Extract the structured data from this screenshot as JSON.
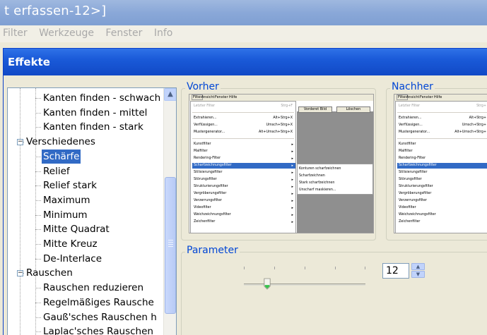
{
  "app": {
    "title": "t erfassen-12>]",
    "menu": [
      "Filter",
      "Werkzeuge",
      "Fenster",
      "Info"
    ]
  },
  "dialog": {
    "title": "Effekte"
  },
  "tree": {
    "items": [
      {
        "label": "Kanten finden - schwach",
        "level": 2
      },
      {
        "label": "Kanten finden - mittel",
        "level": 2
      },
      {
        "label": "Kanten finden - stark",
        "level": 2
      },
      {
        "label": "Verschiedenes",
        "level": 1,
        "expanded": true
      },
      {
        "label": "Schärfe",
        "level": 2,
        "selected": true
      },
      {
        "label": "Relief",
        "level": 2
      },
      {
        "label": "Relief stark",
        "level": 2
      },
      {
        "label": "Maximum",
        "level": 2
      },
      {
        "label": "Minimum",
        "level": 2
      },
      {
        "label": "Mitte Quadrat",
        "level": 2
      },
      {
        "label": "Mitte Kreuz",
        "level": 2
      },
      {
        "label": "De-Interlace",
        "level": 2
      },
      {
        "label": "Rauschen",
        "level": 1,
        "expanded": true
      },
      {
        "label": "Rauschen reduzieren",
        "level": 2
      },
      {
        "label": "Regelmäßiges Rausche",
        "level": 2
      },
      {
        "label": "Gauß'sches Rauschen h",
        "level": 2
      },
      {
        "label": "Laplac'sches Rauschen",
        "level": 2
      }
    ],
    "expander_symbol": "−",
    "scroll_up_icon": "▲"
  },
  "vorher": {
    "legend": "Vorher",
    "menubar": [
      "Filter",
      "Ansicht",
      "Fenster",
      "Hilfe"
    ],
    "items": [
      {
        "label": "Letzter Filter",
        "shortcut": "Strg+F",
        "gray": true
      },
      {
        "label": "Extrahieren...",
        "shortcut": "Alt+Strg+X"
      },
      {
        "label": "Verflüssigen...",
        "shortcut": "Umsch+Strg+X"
      },
      {
        "label": "Mustergenerator...",
        "shortcut": "Alt+Umsch+Strg+X"
      },
      {
        "label": "Kunstfilter",
        "arrow": true
      },
      {
        "label": "Malfilter",
        "arrow": true
      },
      {
        "label": "Rendering-Filter",
        "arrow": true
      },
      {
        "label": "Scharfzeichnungsfilter",
        "arrow": true,
        "selected": true
      },
      {
        "label": "Stilisierungsfilter",
        "arrow": true
      },
      {
        "label": "Störungsfilter",
        "arrow": true
      },
      {
        "label": "Strukturierungsfilter",
        "arrow": true
      },
      {
        "label": "Vergröberungsfilter",
        "arrow": true
      },
      {
        "label": "Verzerrungsfilter",
        "arrow": true
      },
      {
        "label": "Videofilter",
        "arrow": true
      },
      {
        "label": "Weichzeichnungsfilter",
        "arrow": true
      },
      {
        "label": "Zeichenfilter",
        "arrow": true
      }
    ],
    "buttons": [
      "Vorderet Bild",
      "Löschen"
    ],
    "submenu": [
      "Konturen scharfzeichnen",
      "Scharfzeichnen",
      "Stark scharfzeichnen",
      "Unscharf maskieren..."
    ]
  },
  "nachher": {
    "legend": "Nachher",
    "menubar": [
      "Filter",
      "Ansicht",
      "Fenster",
      "Hilfe"
    ],
    "items": [
      {
        "label": "Letzter Filter",
        "shortcut": "Strg+",
        "gray": true
      },
      {
        "label": "Extrahieren...",
        "shortcut": "Alt+Strg+"
      },
      {
        "label": "Verflüssigen...",
        "shortcut": "Umsch+Strg+"
      },
      {
        "label": "Mustergenerator...",
        "shortcut": "Alt+Umsch+Strg+"
      },
      {
        "label": "Kunstfilter"
      },
      {
        "label": "Malfilter"
      },
      {
        "label": "Rendering-Filter"
      },
      {
        "label": "Scharfzeichnungsfilter",
        "selected": true
      },
      {
        "label": "Stilisierungsfilter"
      },
      {
        "label": "Störungsfilter"
      },
      {
        "label": "Strukturierungsfilter"
      },
      {
        "label": "Vergröberungsfilter"
      },
      {
        "label": "Verzerrungsfilter"
      },
      {
        "label": "Videofilter"
      },
      {
        "label": "Weichzeichnungsfilter"
      },
      {
        "label": "Zeichenfilter"
      }
    ]
  },
  "parameter": {
    "legend": "Parameter",
    "value": "12",
    "slider_fraction": 0.2,
    "spin_up_icon": "▲",
    "spin_down_icon": "▼"
  }
}
